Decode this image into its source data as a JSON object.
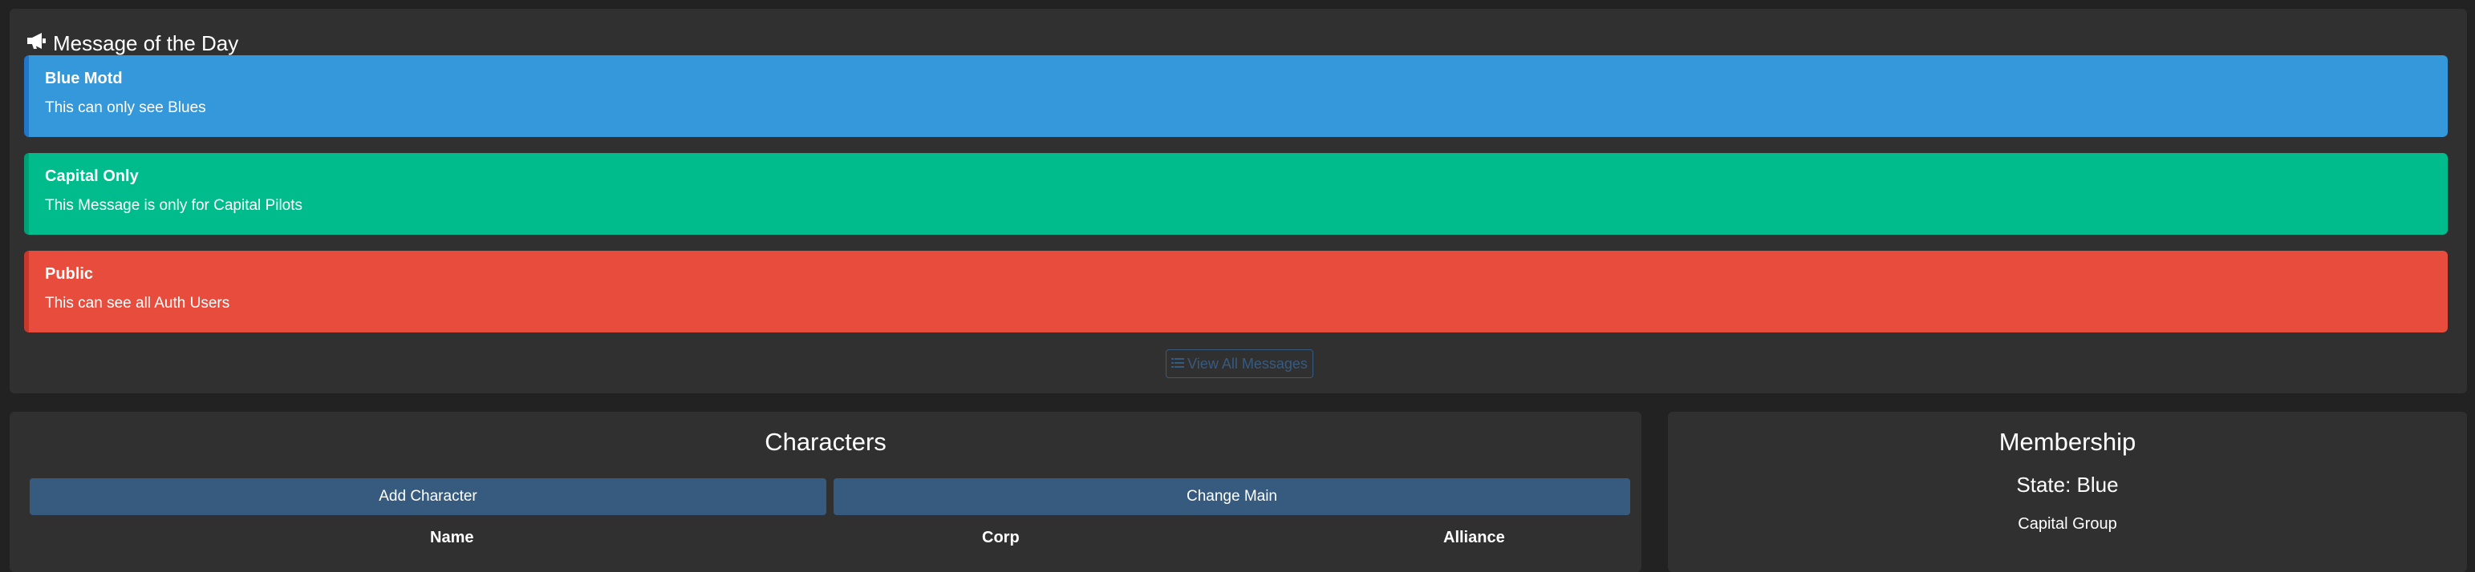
{
  "motd": {
    "title": "Message of the Day",
    "icon": "bullhorn-icon",
    "messages": [
      {
        "title": "Blue Motd",
        "body": "This can only see Blues",
        "color": "#3498db"
      },
      {
        "title": "Capital Only",
        "body": "This Message is only for Capital Pilots",
        "color": "#00bc8c"
      },
      {
        "title": "Public",
        "body": "This can see all Auth Users",
        "color": "#e74c3c"
      }
    ],
    "view_all_label": "View All Messages",
    "view_all_icon": "list-icon"
  },
  "characters": {
    "title": "Characters",
    "add_label": "Add Character",
    "change_main_label": "Change Main",
    "columns": [
      "Name",
      "Corp",
      "Alliance"
    ]
  },
  "membership": {
    "title": "Membership",
    "state": "State: Blue",
    "group": "Capital Group"
  },
  "colors": {
    "background": "#222222",
    "panel": "#303030",
    "primary": "#375a7f"
  }
}
